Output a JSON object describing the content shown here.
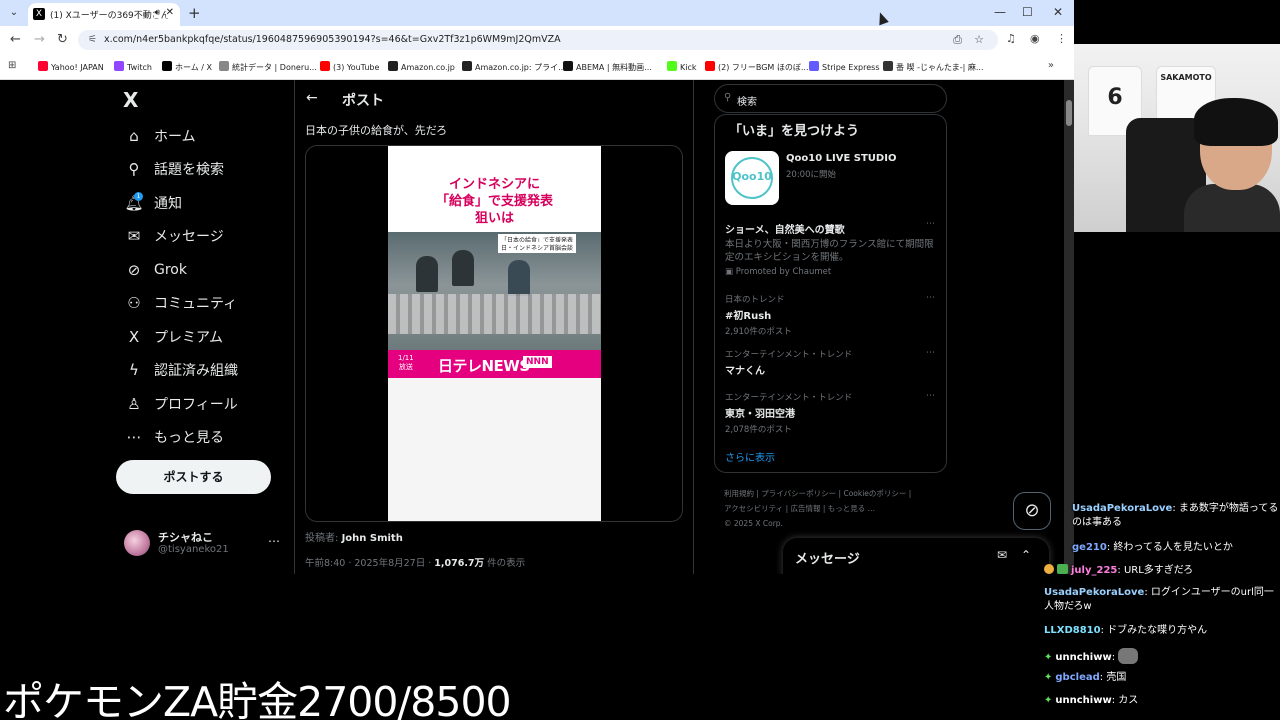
{
  "browser": {
    "tab": {
      "title": "(1) Xユーザーの369不動さん",
      "favicon": "X"
    },
    "url": "x.com/n4er5bankpkqfqe/status/1960487596905390194?s=46&t=Gxv2Tf3z1p6WM9mJ2QmVZA",
    "bookmarks": [
      {
        "label": "Yahoo! JAPAN",
        "color": "#ff0033"
      },
      {
        "label": "Twitch",
        "color": "#9146ff"
      },
      {
        "label": "ホーム / X",
        "color": "#000000"
      },
      {
        "label": "統計データ | Doneru...",
        "color": "#888888"
      },
      {
        "label": "(3) YouTube",
        "color": "#ff0000"
      },
      {
        "label": "Amazon.co.jp",
        "color": "#222222"
      },
      {
        "label": "Amazon.co.jp: プライ...",
        "color": "#222222"
      },
      {
        "label": "ABEMA | 無料動画...",
        "color": "#111111"
      },
      {
        "label": "Kick",
        "color": "#53fc18"
      },
      {
        "label": "(2) フリーBGM ほのぼ...",
        "color": "#ff0000"
      },
      {
        "label": "Stripe Express",
        "color": "#635bff"
      },
      {
        "label": "番 喫 -じゃんたま-| 麻...",
        "color": "#333333"
      }
    ]
  },
  "x": {
    "logo": "X",
    "nav": [
      {
        "label": "ホーム",
        "icon": "⌂"
      },
      {
        "label": "話題を検索",
        "icon": "⚲"
      },
      {
        "label": "通知",
        "icon": "🔔︎"
      },
      {
        "label": "メッセージ",
        "icon": "✉"
      },
      {
        "label": "Grok",
        "icon": "⊘"
      },
      {
        "label": "コミュニティ",
        "icon": "⚇"
      },
      {
        "label": "プレミアム",
        "icon": "X"
      },
      {
        "label": "認証済み組織",
        "icon": "ϟ"
      },
      {
        "label": "プロフィール",
        "icon": "♙"
      },
      {
        "label": "もっと見る",
        "icon": "⋯"
      }
    ],
    "notif_count": "1",
    "post_button": "ポストする",
    "account": {
      "name": "チシャねこ",
      "handle": "@tisyaneko21"
    },
    "post": {
      "header": "ポスト",
      "text": "日本の子供の給食が、先だろ",
      "video": {
        "headline_1": "インドネシアに",
        "headline_2": "「給食」で支援発表",
        "headline_3": "狙いは",
        "caption_1": "「日本の給食」で支援発表",
        "caption_2": "日・インドネシア首脳会談",
        "date_1": "1/11",
        "date_2": "放送",
        "logo": "日テレNEWS",
        "nnn": "NNN"
      },
      "author_label": "投稿者:",
      "author": "John Smith",
      "time": "午前8:40 · 2025年8月27日 · ",
      "views": "1,076.7万",
      "views_label": " 件の表示"
    },
    "search_placeholder": "検索",
    "trends_title": "「いま」を見つけよう",
    "live": {
      "name": "Qoo10 LIVE STUDIO",
      "time": "20:00に開始",
      "logo": "Qoo10"
    },
    "promo": {
      "name": "ショーメ、自然美への賛歌",
      "desc": "本日より大阪・関西万博のフランス館にて期間限定のエキシビションを開催。",
      "promoted": "Promoted by Chaumet"
    },
    "trends": [
      {
        "ctx": "日本のトレンド",
        "name": "#初Rush",
        "count": "2,910件のポスト"
      },
      {
        "ctx": "エンターテインメント・トレンド",
        "name": "マナくん",
        "count": ""
      },
      {
        "ctx": "エンターテインメント・トレンド",
        "name": "東京・羽田空港",
        "count": "2,078件のポスト"
      }
    ],
    "show_more": "さらに表示",
    "footer": [
      "利用規約",
      "プライバシーポリシー",
      "Cookieのポリシー",
      "アクセシビリティ",
      "広告情報",
      "もっと見る …",
      "© 2025 X Corp."
    ],
    "messages": "メッセージ"
  },
  "chat": [
    {
      "user": "UsadaPekoraLove",
      "text": "まあ数字が物語ってるのは事ある",
      "color": "#9ad0ff",
      "badge": ""
    },
    {
      "user": "ge210",
      "text": "終わってる人を見たいとか",
      "color": "#7fa8ff",
      "badge": ""
    },
    {
      "user": "july_225",
      "text": "URL多すぎだろ",
      "color": "#ff7fe0",
      "badge": "green"
    },
    {
      "user": "UsadaPekoraLove",
      "text": "ログインユーザーのurl同一人物だろw",
      "color": "#9ad0ff",
      "badge": ""
    },
    {
      "user": "LLXD8810",
      "text": "ドブみたな喋り方やん",
      "color": "#7fe0ff",
      "badge": ""
    },
    {
      "user": "unnchiww",
      "text": "",
      "color": "#ffffff",
      "badge": "diamond",
      "emote": true
    },
    {
      "user": "gbclead",
      "text": "壳国",
      "color": "#7fa8ff",
      "badge": "diamond"
    },
    {
      "user": "unnchiww",
      "text": "カス",
      "color": "#ffffff",
      "badge": "diamond"
    }
  ],
  "overlay": "ポケモンZA貯金2700/8500",
  "webcam": {
    "shirt_1": "6",
    "shirt_2": "SAKAMOTO"
  }
}
